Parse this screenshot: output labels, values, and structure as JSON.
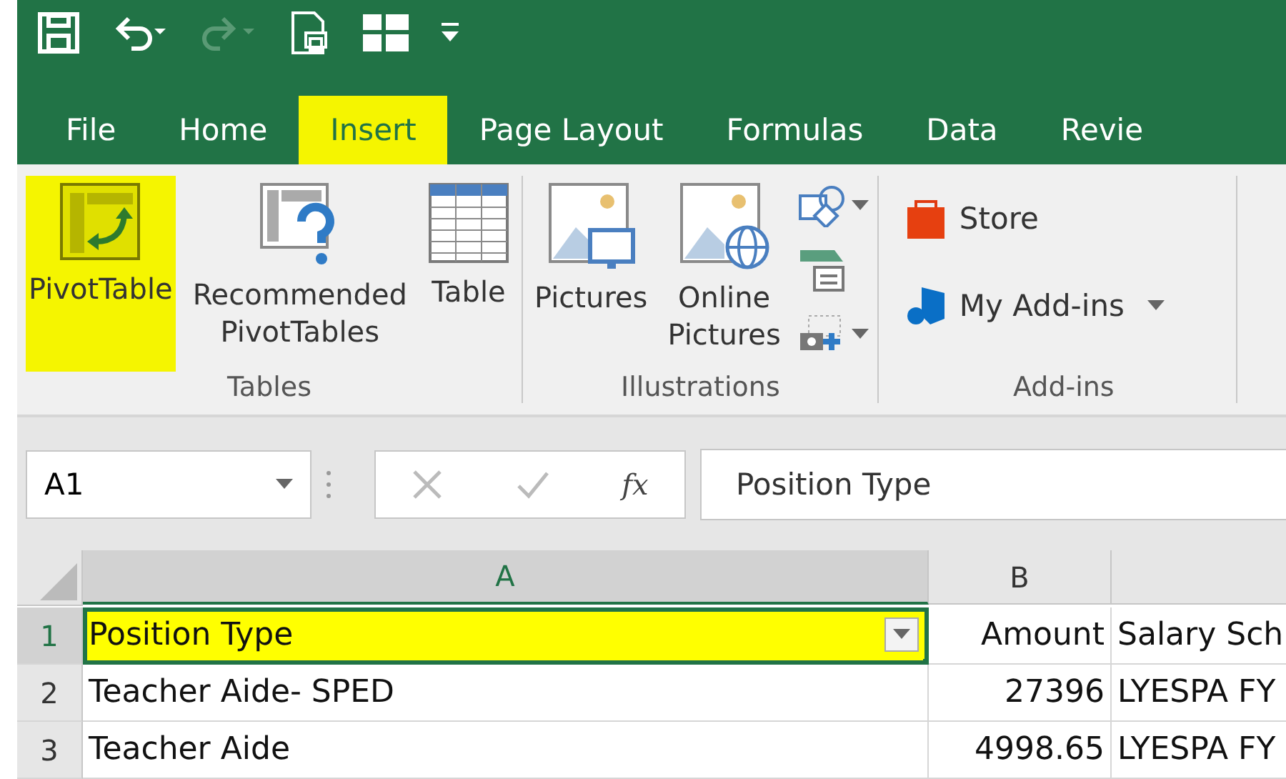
{
  "quick_access": [
    {
      "kind": "save",
      "disabled": false
    },
    {
      "kind": "undo",
      "disabled": false
    },
    {
      "kind": "redo",
      "disabled": true
    },
    {
      "kind": "print-preview",
      "disabled": false
    },
    {
      "kind": "layout",
      "disabled": false
    },
    {
      "kind": "customize",
      "disabled": false
    }
  ],
  "tabs": [
    {
      "label": "File",
      "selected": false,
      "highlighted": false
    },
    {
      "label": "Home",
      "selected": false,
      "highlighted": false
    },
    {
      "label": "Insert",
      "selected": true,
      "highlighted": true
    },
    {
      "label": "Page Layout",
      "selected": false,
      "highlighted": false
    },
    {
      "label": "Formulas",
      "selected": false,
      "highlighted": false
    },
    {
      "label": "Data",
      "selected": false,
      "highlighted": false
    },
    {
      "label": "Revie",
      "selected": false,
      "highlighted": false
    }
  ],
  "ribbon_groups": [
    {
      "label": "Tables",
      "buttons": [
        {
          "kind": "pivot",
          "label": "PivotTable",
          "highlighted": true
        },
        {
          "kind": "recommended",
          "label": "Recommended PivotTables",
          "highlighted": false
        },
        {
          "kind": "table",
          "label": "Table",
          "highlighted": false
        }
      ]
    },
    {
      "label": "Illustrations",
      "buttons": [
        {
          "kind": "pictures",
          "label": "Pictures",
          "highlighted": false
        },
        {
          "kind": "online",
          "label": "Online Pictures",
          "highlighted": false
        }
      ],
      "small_tools": [
        {
          "kind": "shapes",
          "dropdown": true
        },
        {
          "kind": "smartart",
          "dropdown": false
        },
        {
          "kind": "screenshot",
          "dropdown": true
        }
      ]
    },
    {
      "label": "Add-ins",
      "items": [
        {
          "kind": "store",
          "label": "Store",
          "dropdown": false
        },
        {
          "kind": "addins",
          "label": "My Add-ins",
          "dropdown": true
        }
      ]
    }
  ],
  "formula_bar": {
    "name_box": "A1",
    "function_label": "fx",
    "value": "Position Type"
  },
  "grid": {
    "columns": [
      {
        "label": "A",
        "selected": true,
        "kind": "text"
      },
      {
        "label": "B",
        "selected": false,
        "kind": "number"
      },
      {
        "selected": false,
        "kind": "text"
      }
    ],
    "rows": [
      {
        "number": "1",
        "selected": true,
        "cells": [
          {
            "text": "Position Type",
            "highlighted": true,
            "active": true,
            "filter": true
          },
          {
            "text": "Amount",
            "highlighted": false,
            "active": false,
            "filter": false
          },
          {
            "text": "Salary Sch",
            "highlighted": false,
            "active": false,
            "filter": false
          }
        ]
      },
      {
        "number": "2",
        "selected": false,
        "cells": [
          {
            "text": "Teacher Aide- SPED",
            "highlighted": false,
            "active": false,
            "filter": false
          },
          {
            "text": "27396",
            "highlighted": false,
            "active": false,
            "filter": false
          },
          {
            "text": "LYESPA FY",
            "highlighted": false,
            "active": false,
            "filter": false
          }
        ]
      },
      {
        "number": "3",
        "selected": false,
        "cells": [
          {
            "text": "Teacher Aide",
            "highlighted": false,
            "active": false,
            "filter": false
          },
          {
            "text": "4998.65",
            "highlighted": false,
            "active": false,
            "filter": false
          },
          {
            "text": "LYESPA FY",
            "highlighted": false,
            "active": false,
            "filter": false
          }
        ]
      }
    ]
  }
}
